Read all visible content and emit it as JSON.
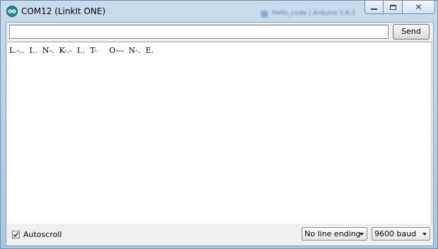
{
  "window": {
    "title": "COM12 (LinkIt ONE)",
    "background_task_title": "Hello_code | Arduino 1.6.1"
  },
  "caption": {
    "minimize_icon": "minimize-icon",
    "maximize_icon": "maximize-icon",
    "close_icon": "close-icon",
    "close_glyph": "✕"
  },
  "toolbar": {
    "input_value": "",
    "send_label": "Send"
  },
  "output": {
    "lines": [
      "L.-..  I..  N-.  K-.-  I..  T-     O---  N-.  E."
    ]
  },
  "footer": {
    "autoscroll_label": "Autoscroll",
    "autoscroll_checked": true,
    "line_ending_selected": "No line ending",
    "baud_selected": "9600 baud"
  },
  "colors": {
    "app_icon": "#1b8a8e",
    "frame": "#bcd3e8",
    "client_bg": "#f0f0f0",
    "output_bg": "#ffffff"
  }
}
